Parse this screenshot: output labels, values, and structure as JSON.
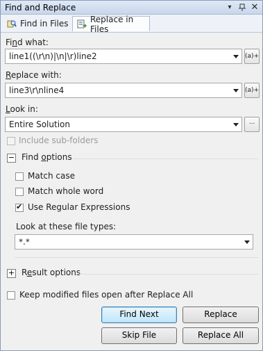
{
  "window": {
    "title": "Find and Replace"
  },
  "titlebar": {
    "dropdown_icon": "chevron-down-icon",
    "pin_icon": "pin-icon",
    "close_icon": "close-icon"
  },
  "tabs": [
    {
      "label": "Find in Files",
      "icon": "find-in-files-icon",
      "active": false
    },
    {
      "label": "Replace in Files",
      "icon": "replace-in-files-icon",
      "active": true
    }
  ],
  "find": {
    "label": "Find what:",
    "value": "line1((\\r\\n)|\\n|\\r)line2",
    "builder_button": "(a)+"
  },
  "replace": {
    "label": "Replace with:",
    "value": "line3\\r\\nline4",
    "builder_button": "(a)+"
  },
  "look_in": {
    "label": "Look in:",
    "value": "Entire Solution",
    "browse_button": "..."
  },
  "include_subfolders": {
    "label": "Include sub-folders",
    "checked": false,
    "enabled": false
  },
  "find_options": {
    "header": "Find options",
    "expander": "−",
    "match_case": {
      "label": "Match case",
      "checked": false
    },
    "match_whole_word": {
      "label": "Match whole word",
      "checked": false
    },
    "use_regex": {
      "label": "Use Regular Expressions",
      "checked": true
    },
    "file_types_label": "Look at these file types:",
    "file_types_value": "*.*"
  },
  "result_options": {
    "header": "Result options",
    "expander": "+"
  },
  "keep_open": {
    "label": "Keep modified files open after Replace All",
    "checked": false
  },
  "buttons": {
    "find_next": "Find Next",
    "replace": "Replace",
    "skip_file": "Skip File",
    "replace_all": "Replace All"
  }
}
